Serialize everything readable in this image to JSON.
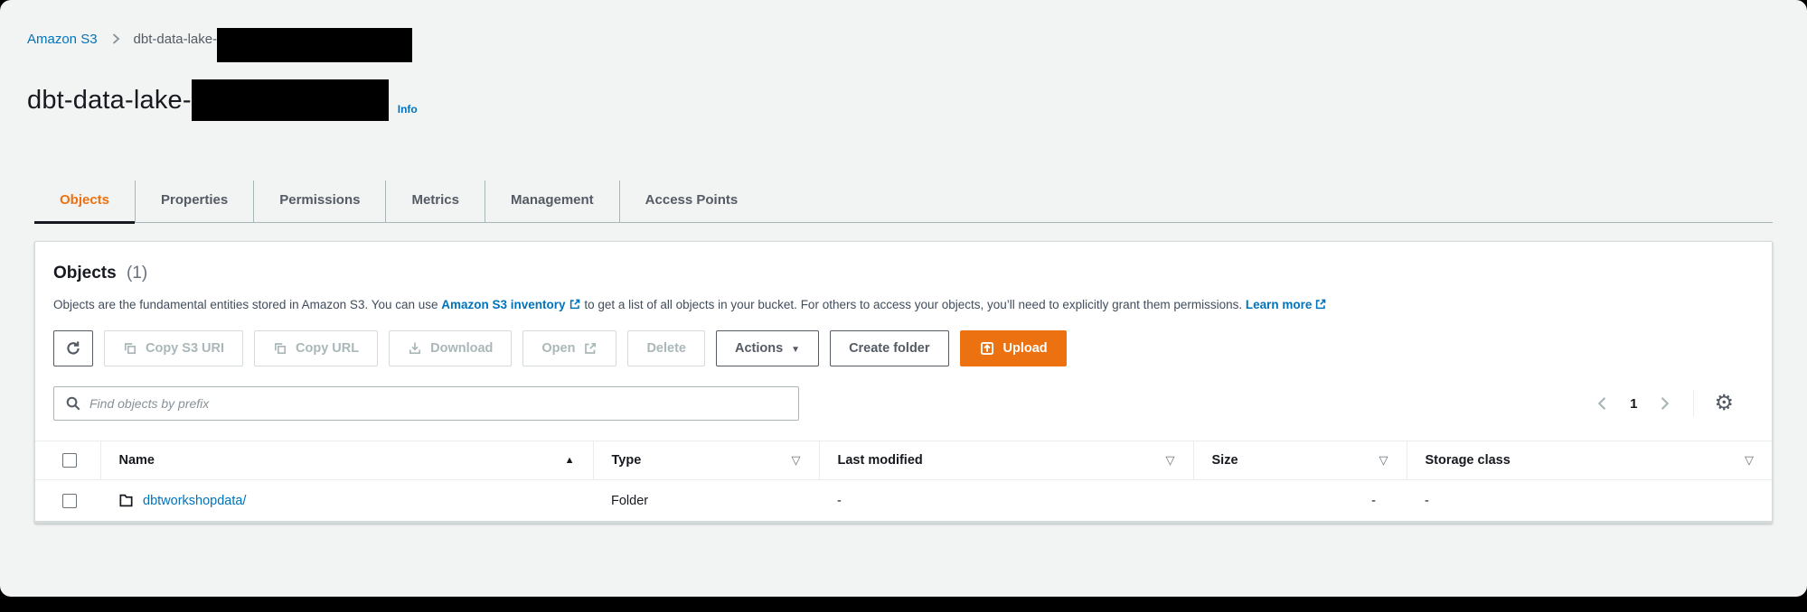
{
  "colors": {
    "accent_orange": "#ec7211",
    "link_blue": "#0073bb",
    "text_dark": "#16191f",
    "text_muted": "#545b64",
    "disabled": "#aab7b8",
    "page_bg": "#f2f3f3"
  },
  "breadcrumb": {
    "root": "Amazon S3",
    "current_prefix": "dbt-data-lake-",
    "current_redacted": true
  },
  "header": {
    "title_prefix": "dbt-data-lake-",
    "title_redacted": true,
    "info_label": "Info"
  },
  "tabs": {
    "items": [
      {
        "label": "Objects",
        "active": true
      },
      {
        "label": "Properties",
        "active": false
      },
      {
        "label": "Permissions",
        "active": false
      },
      {
        "label": "Metrics",
        "active": false
      },
      {
        "label": "Management",
        "active": false
      },
      {
        "label": "Access Points",
        "active": false
      }
    ]
  },
  "panel": {
    "heading": "Objects",
    "count": "(1)",
    "description": {
      "part1": "Objects are the fundamental entities stored in Amazon S3. You can use ",
      "link1": "Amazon S3 inventory",
      "part2": " to get a list of all objects in your bucket. For others to access your objects, you’ll need to explicitly grant them permissions. ",
      "link2": "Learn more"
    },
    "toolbar": {
      "copy_s3_uri": "Copy S3 URI",
      "copy_url": "Copy URL",
      "download": "Download",
      "open": "Open",
      "delete": "Delete",
      "actions": "Actions",
      "create_folder": "Create folder",
      "upload": "Upload"
    },
    "search": {
      "placeholder": "Find objects by prefix"
    },
    "pagination": {
      "page": "1"
    },
    "table": {
      "columns": [
        {
          "label": "Name",
          "sort": "asc"
        },
        {
          "label": "Type",
          "sort": "none"
        },
        {
          "label": "Last modified",
          "sort": "none"
        },
        {
          "label": "Size",
          "sort": "none"
        },
        {
          "label": "Storage class",
          "sort": "none"
        }
      ],
      "rows": [
        {
          "name": "dbtworkshopdata/",
          "type": "Folder",
          "last_modified": "-",
          "size": "-",
          "storage_class": "-"
        }
      ]
    }
  },
  "icons": {
    "caret_down": "▼",
    "sort_ascending": "▲",
    "sort_inactive": "▽",
    "gear": "⚙"
  }
}
